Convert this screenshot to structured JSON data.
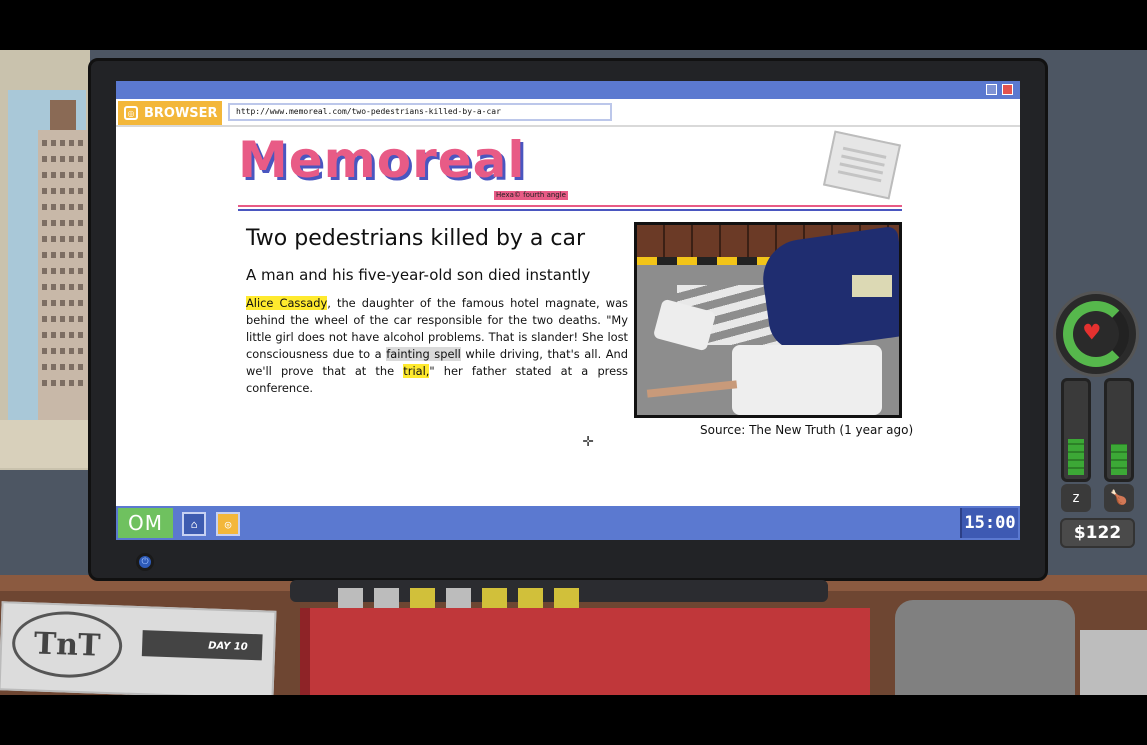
{
  "browser": {
    "tab_label": "BROWSER",
    "url": "http://www.memoreal.com/two-pedestrians-killed-by-a-car"
  },
  "site": {
    "logo": "Memoreal",
    "tagline": "Hexa© fourth angle"
  },
  "article": {
    "headline": "Two pedestrians killed by a car",
    "subhead": "A man and his five-year-old son died instantly",
    "body": {
      "name": "Alice Cassady",
      "part1": ", the daughter of the famous hotel magnate, was behind the wheel of the car responsible for the two deaths. \"My little girl does not have alcohol problems. That is slander! She lost consciousness due to a ",
      "keyword1": "fainting spell",
      "part2": " while driving, that's all. And we'll prove that at the ",
      "keyword2": "trial,",
      "part3": "\" her father stated at a press conference."
    },
    "source": "Source: The New Truth (1 year ago)"
  },
  "taskbar": {
    "start_label": "OM",
    "clock": "15:00",
    "icons": [
      "home-icon",
      "browser-icon"
    ]
  },
  "hud": {
    "money": "$122",
    "health_fraction": 0.75,
    "sleep_fraction": 0.4,
    "hunger_fraction": 0.35
  },
  "desk": {
    "newspaper_logo": "TnT",
    "day_label": "DAY 10"
  },
  "colors": {
    "accent_blue": "#5b79d0",
    "logo_pink": "#e85b86",
    "highlight_yellow": "#ffea2e",
    "browser_orange": "#f3b73a",
    "health_green": "#56b84c"
  }
}
